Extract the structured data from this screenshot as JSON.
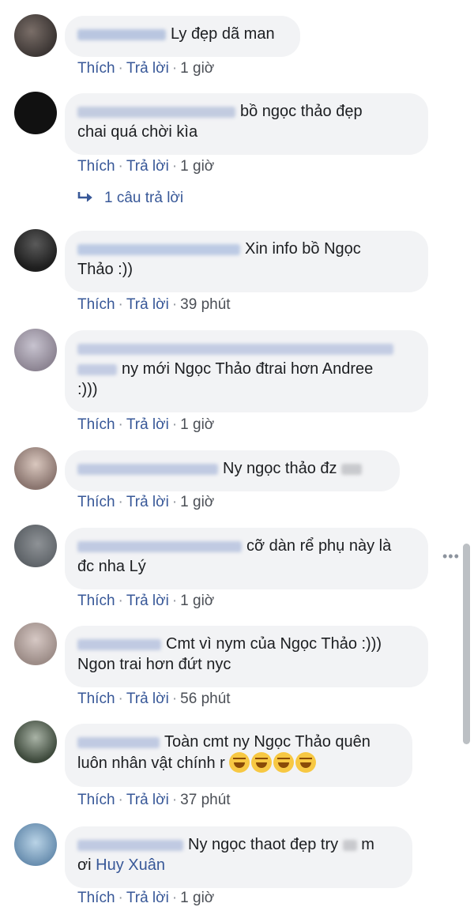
{
  "labels": {
    "like": "Thích",
    "reply": "Trả lời",
    "dot": "·"
  },
  "comments": [
    {
      "text": "Ly đẹp dã man",
      "time": "1 giờ"
    },
    {
      "text": "bồ ngọc thảo đẹp chai quá chời kìa",
      "text_line1": "bồ ngọc thảo đẹp",
      "text_line2": "chai quá chời kìa",
      "time": "1 giờ",
      "replies_label": "1 câu trả lời"
    },
    {
      "text_line1": "Xin info bồ Ngọc",
      "text_line2": "Thảo :))",
      "time": "39 phút"
    },
    {
      "text_line1": "ny mới Ngọc Thảo đtrai hơn Andree",
      "text_line2": ":)))",
      "time": "1 giờ"
    },
    {
      "text": "Ny ngọc thảo đz",
      "time": "1 giờ"
    },
    {
      "text_line1": "cỡ dàn rể phụ này là",
      "text_line2": "đc nha Lý",
      "time": "1 giờ"
    },
    {
      "text_line1": "Cmt vì nym của Ngọc Thảo :)))",
      "text_line2": "Ngon trai hơn đứt nyc",
      "time": "56 phút"
    },
    {
      "text_line1": "Toàn cmt ny Ngọc Thảo quên",
      "text_line2": "luôn nhân vật chính r",
      "time": "37 phút"
    },
    {
      "text_line1": "Ny ngọc thaot đẹp try",
      "text_line1b": "m",
      "text_line2": "ơi",
      "mention": "Huy Xuân",
      "time": "1 giờ"
    }
  ],
  "icons": {
    "reply_arrow": "reply-arrow-icon",
    "more": "more-options-icon",
    "emoji": "laughing-tears-emoji"
  },
  "colors": {
    "link": "#385898",
    "bubble": "#f2f3f5",
    "meta": "#4b4f56"
  }
}
